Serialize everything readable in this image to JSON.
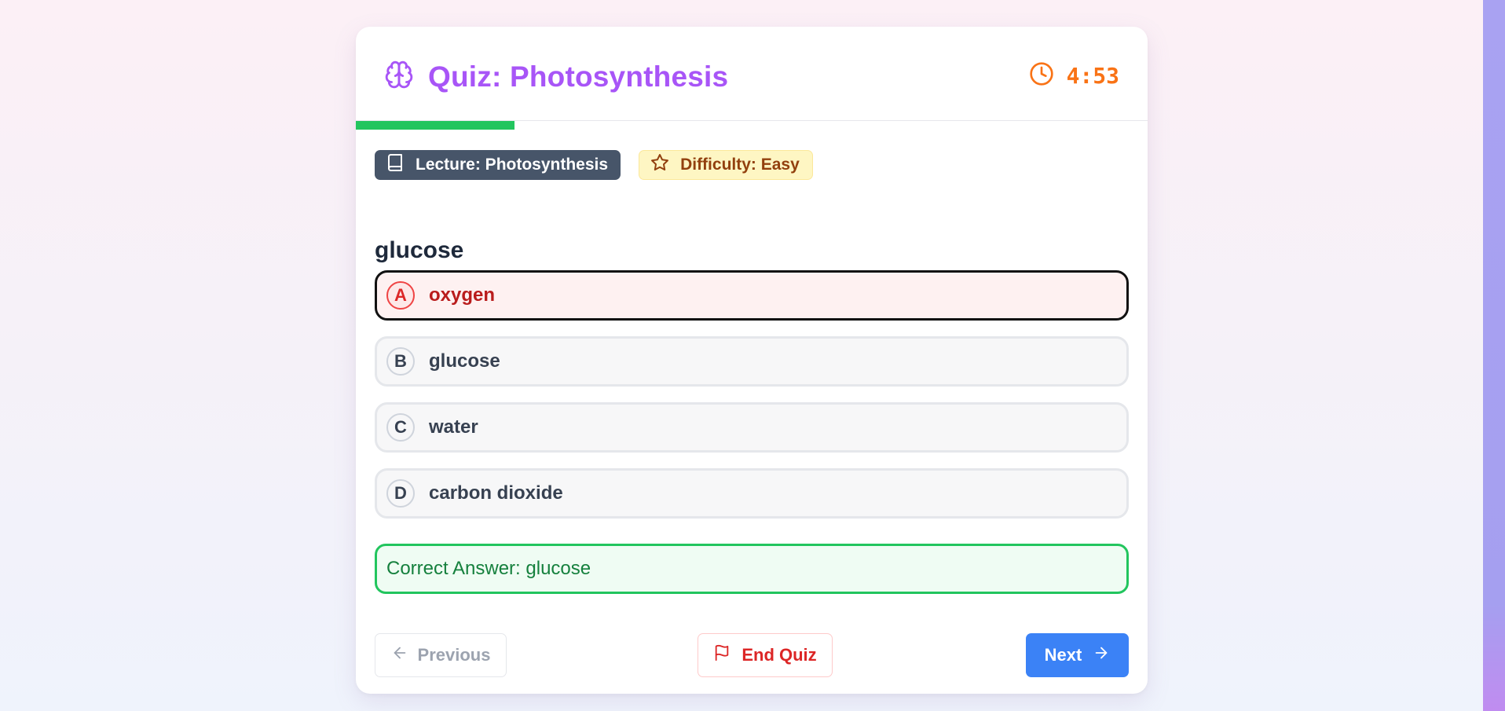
{
  "quiz": {
    "title": "Quiz: Photosynthesis",
    "timer": "4:53",
    "progress": 0.2,
    "tags": {
      "lecture": "Lecture: Photosynthesis",
      "difficulty": "Difficulty: Easy"
    },
    "question": "glucose",
    "options": [
      {
        "letter": "A",
        "text": "oxygen",
        "state": "selected-wrong"
      },
      {
        "letter": "B",
        "text": "glucose",
        "state": "default"
      },
      {
        "letter": "C",
        "text": "water",
        "state": "default"
      },
      {
        "letter": "D",
        "text": "carbon dioxide",
        "state": "default"
      }
    ],
    "feedback": "Correct Answer: glucose"
  },
  "buttons": {
    "previous": "Previous",
    "end": "End Quiz",
    "next": "Next"
  },
  "colors": {
    "title": "#a855f7",
    "timer": "#f97316",
    "progress": "#22c55e",
    "wrong": "#ef4444",
    "correct": "#22c55e",
    "primary": "#3b82f6"
  },
  "icons": {
    "title": "brain-icon",
    "timer": "clock-icon",
    "lecture": "book-icon",
    "difficulty": "star-icon",
    "previous": "arrow-left-icon",
    "end": "flag-icon",
    "next": "arrow-right-icon"
  }
}
